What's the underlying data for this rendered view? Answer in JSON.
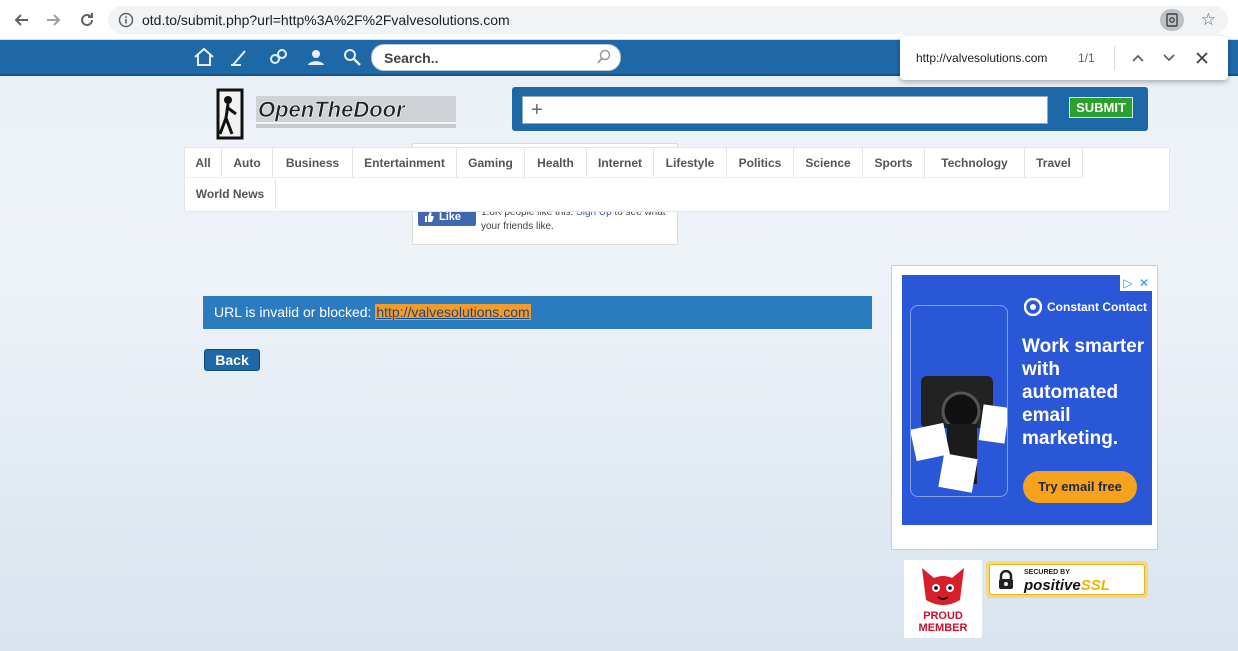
{
  "browser": {
    "url": "otd.to/submit.php?url=http%3A%2F%2Fvalvesolutions.com"
  },
  "topbar": {
    "search_placeholder": "Search.."
  },
  "find_bar": {
    "query": "http://valvesolutions.com",
    "count": "1/1"
  },
  "logo": {
    "text": "OpenTheDoor"
  },
  "submit_box": {
    "plus": "+",
    "button_label": "SUBMIT"
  },
  "facebook_widget": {
    "like_label": "Like",
    "text_prefix": "1.8K people like this.",
    "link": "Sign Up",
    "text_suffix": "to see what your friends like."
  },
  "categories": [
    "All",
    "Auto",
    "Business",
    "Entertainment",
    "Gaming",
    "Health",
    "Internet",
    "Lifestyle",
    "Politics",
    "Science",
    "Sports",
    "Technology",
    "Travel",
    "World News"
  ],
  "message": {
    "text": "URL is invalid or blocked:",
    "url": "http://valvesolutions.com"
  },
  "back_button": "Back",
  "ad": {
    "brand": "Constant Contact",
    "headline": "Work smarter with automated email marketing.",
    "cta": "Try email free"
  },
  "badges": {
    "proud_member": "PROUD MEMBER",
    "ssl_top": "SECURED BY",
    "ssl_name_part1": "positive",
    "ssl_name_part2": "SSL"
  },
  "colors": {
    "brand_blue": "#1f68a8",
    "highlight": "#f39c2b",
    "submit_green": "#2aa12a",
    "ad_blue": "#2a57d8"
  }
}
